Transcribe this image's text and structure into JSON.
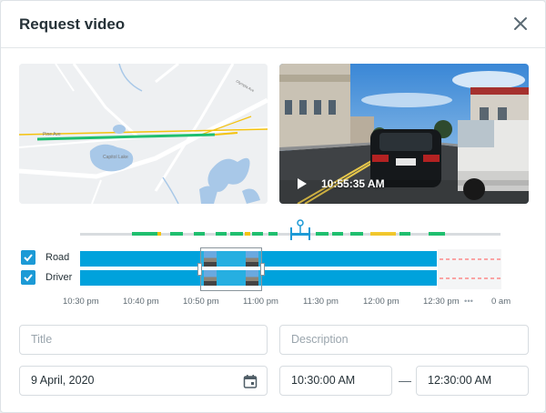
{
  "dialog": {
    "title": "Request video"
  },
  "video": {
    "timestamp": "10:55:35 AM"
  },
  "tracks": [
    {
      "label": "Road",
      "checked": true
    },
    {
      "label": "Driver",
      "checked": true
    }
  ],
  "timeline": {
    "ticks": [
      "10:30 pm",
      "10:40 pm",
      "10:50 pm",
      "11:00 pm",
      "11:30 pm",
      "12:00 pm",
      "12:30 pm",
      "0 am"
    ],
    "more_label": "•••"
  },
  "map": {
    "labels": [
      "Capitol Lake",
      "Pine Ave",
      "Olympia Ave"
    ]
  },
  "form": {
    "title_placeholder": "Title",
    "description_placeholder": "Description",
    "date_value": "9 April, 2020",
    "start_time": "10:30:00 AM",
    "end_time": "12:30:00 AM",
    "range_separator": "—"
  },
  "colors": {
    "accent": "#1c9ad6",
    "track": "#00a2dc",
    "route": "#1fbf6f",
    "warn": "#f4c20d",
    "gap": "#ff5252"
  }
}
